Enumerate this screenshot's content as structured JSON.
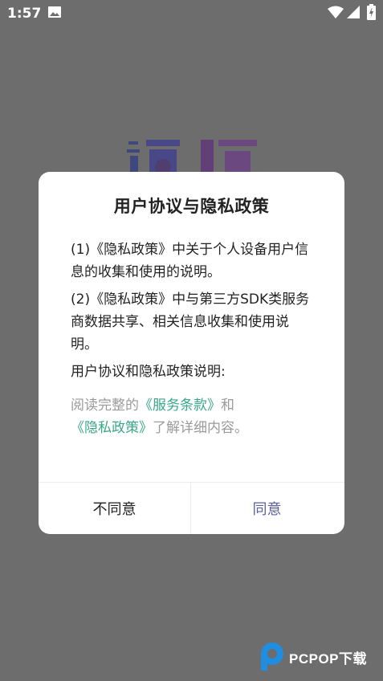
{
  "status_bar": {
    "time": "1:57",
    "icons": [
      "image-icon",
      "wifi-icon",
      "signal-icon",
      "battery-icon"
    ]
  },
  "dialog": {
    "title": "用户协议与隐私政策",
    "paragraphs": [
      "(1)《隐私政策》中关于个人设备用户信息的收集和使用的说明。",
      "(2)《隐私政策》中与第三方SDK类服务商数据共享、相关信息收集和使用说明。",
      "用户协议和隐私政策说明:"
    ],
    "intro": {
      "prefix": "阅读完整的",
      "terms_link": "《服务条款》",
      "connector": "和",
      "privacy_link": "《隐私政策》",
      "suffix": "了解详细内容。"
    },
    "buttons": {
      "disagree": "不同意",
      "agree": "同意"
    }
  },
  "watermark": {
    "text": "PCPOP下载"
  },
  "colors": {
    "overlay": "#6d6d6d",
    "link": "#3aa788",
    "agree": "#5b5f9a",
    "logo_blue": "#1f8de0"
  }
}
